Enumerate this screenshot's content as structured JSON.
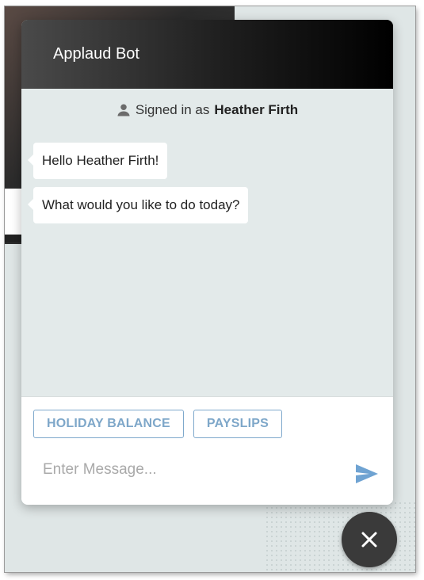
{
  "chat": {
    "title": "Applaud Bot",
    "signed_in_prefix": "Signed in as",
    "user_name": "Heather Firth",
    "messages": [
      {
        "text": "Hello Heather Firth!"
      },
      {
        "text": "What would you like to do today?"
      }
    ],
    "quick_replies": [
      {
        "label": "HOLIDAY BALANCE"
      },
      {
        "label": "PAYSLIPS"
      }
    ],
    "input": {
      "placeholder": "Enter Message...",
      "value": ""
    },
    "icons": {
      "user": "user-icon",
      "send": "send-icon",
      "close": "close-icon"
    }
  },
  "colors": {
    "header_dark": "#000000",
    "chip_accent": "#7ea7c9",
    "send_accent": "#6fa3d2",
    "fab": "#3a3a3a",
    "chat_bg": "#e3eaea"
  }
}
